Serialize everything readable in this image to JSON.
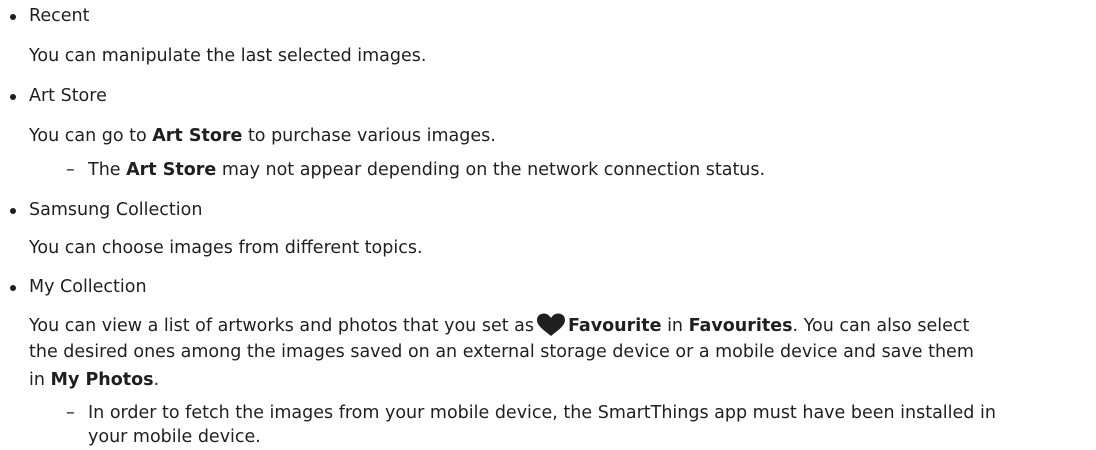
{
  "sections": {
    "recent": {
      "title": "Recent",
      "desc": "You can manipulate the last selected images."
    },
    "art_store": {
      "title": "Art Store",
      "desc_pre": "You can go to ",
      "desc_bold": "Art Store",
      "desc_post": " to purchase various images.",
      "note_pre": "The ",
      "note_bold": "Art Store",
      "note_post": " may not appear depending on the network connection status."
    },
    "samsung_collection": {
      "title": "Samsung Collection",
      "desc": "You can choose images from different topics."
    },
    "my_collection": {
      "title": "My Collection",
      "line1_pre": "You can view a list of artworks and photos that you set as",
      "line1_bold1": "Favourite",
      "line1_mid": " in ",
      "line1_bold2": "Favourites",
      "line1_post": ". You can also select",
      "line2": "the desired ones among the images saved on an external storage device or a mobile device and save them",
      "line3_pre": "in ",
      "line3_bold": "My Photos",
      "line3_post": ".",
      "note_line1": "In order to fetch the images from your mobile device, the SmartThings app must have been installed in",
      "note_line2": "your mobile device."
    }
  },
  "icons": {
    "heart": "heart-icon"
  },
  "colors": {
    "text": "#1f1f1f",
    "heart": "#1f1f1f"
  }
}
